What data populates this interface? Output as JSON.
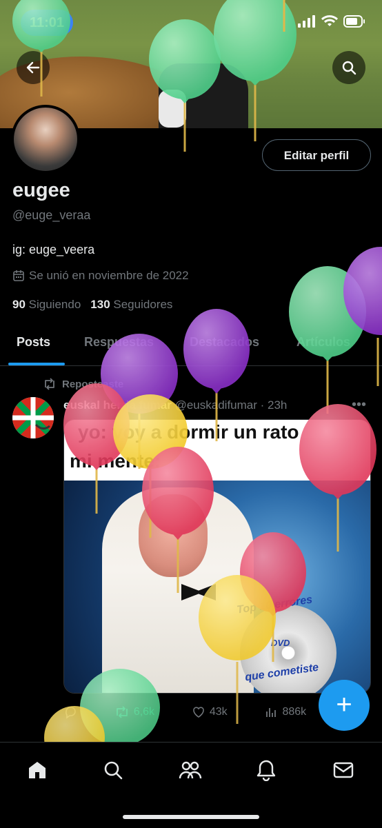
{
  "status_bar": {
    "time": "11:01"
  },
  "colors": {
    "accent": "#1d9bf0",
    "background": "#000000",
    "muted": "#71767b",
    "text": "#e7e9ea"
  },
  "header": {
    "back_icon": "arrow-left-icon",
    "search_icon": "search-icon"
  },
  "profile": {
    "edit_button": "Editar perfil",
    "display_name": "eugee",
    "handle": "@euge_veraa",
    "bio": "ig: euge_veera",
    "joined": "Se unió en noviembre de 2022",
    "following_count": "90",
    "following_label": "Siguiendo",
    "followers_count": "130",
    "followers_label": "Seguidores"
  },
  "tabs": [
    {
      "label": "Posts",
      "active": true
    },
    {
      "label": "Respuestas"
    },
    {
      "label": "Destacados"
    },
    {
      "label": "Artículos"
    }
  ],
  "post": {
    "repost_label": "Reposteaste",
    "author_name": "euskal herria fumar",
    "author_handle": "@euskadifumar",
    "time": "· 23h",
    "more_icon": "more-icon",
    "meme_line1": "yo: voy a dormir un rato",
    "meme_line2": "mi mente:",
    "dvd_line1": "Top 10 errores",
    "dvd_line2": "que cometiste",
    "dvd_label": "DVD",
    "reposts": "6,6k",
    "likes": "43k",
    "views": "886k"
  },
  "fab_label": "+",
  "bottom_nav": [
    "home-icon",
    "search-icon",
    "communities-icon",
    "notifications-icon",
    "messages-icon"
  ]
}
